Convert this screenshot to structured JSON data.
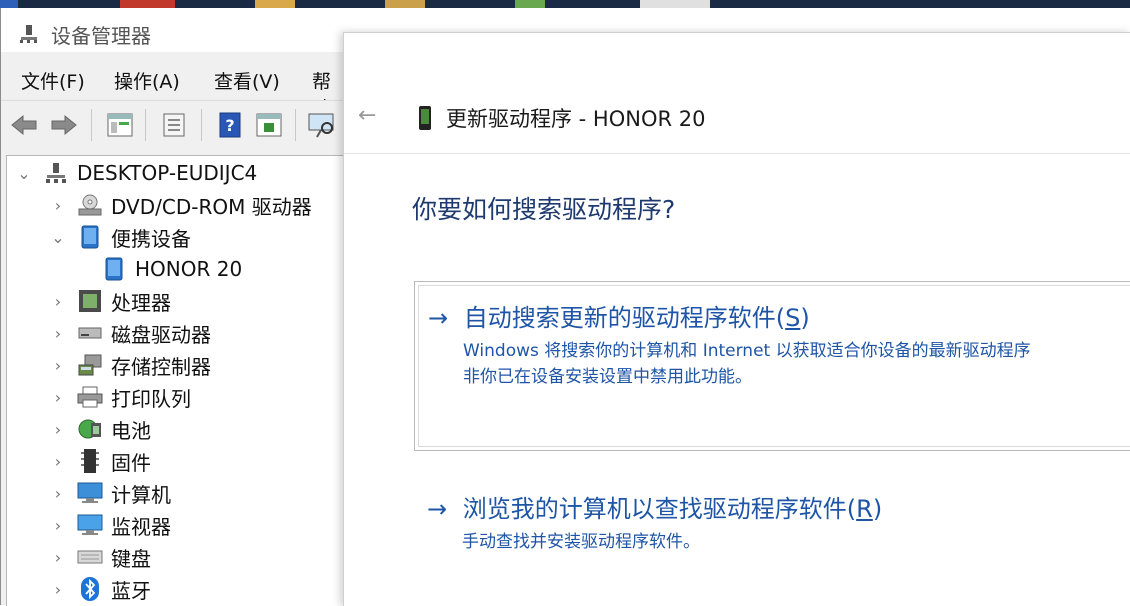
{
  "dm": {
    "title": "设备管理器",
    "menu": [
      "文件(F)",
      "操作(A)",
      "查看(V)",
      "帮助"
    ],
    "tree": {
      "root": "DESKTOP-EUDIJC4",
      "items": [
        {
          "label": "DVD/CD-ROM 驱动器",
          "icon": "dvd-drive-icon"
        },
        {
          "label": "便携设备",
          "icon": "portable-device-icon",
          "expanded": true
        },
        {
          "label": "HONOR 20",
          "icon": "phone-icon",
          "child": true
        },
        {
          "label": "处理器",
          "icon": "processor-icon"
        },
        {
          "label": "磁盘驱动器",
          "icon": "disk-drive-icon"
        },
        {
          "label": "存储控制器",
          "icon": "storage-controller-icon"
        },
        {
          "label": "打印队列",
          "icon": "printer-icon"
        },
        {
          "label": "电池",
          "icon": "battery-icon"
        },
        {
          "label": "固件",
          "icon": "firmware-icon"
        },
        {
          "label": "计算机",
          "icon": "computer-icon"
        },
        {
          "label": "监视器",
          "icon": "monitor-icon"
        },
        {
          "label": "键盘",
          "icon": "keyboard-icon"
        },
        {
          "label": "蓝牙",
          "icon": "bluetooth-icon"
        }
      ]
    }
  },
  "dialog": {
    "title": "更新驱动程序 - HONOR 20",
    "question": "你要如何搜索驱动程序?",
    "option1": {
      "arrow": "→",
      "title_pre": "自动搜索更新的驱动程序软件(",
      "title_key": "S",
      "title_post": ")",
      "desc_line1": "Windows 将搜索你的计算机和 Internet 以获取适合你设备的最新驱动程序",
      "desc_line2": "非你已在设备安装设置中禁用此功能。"
    },
    "option2": {
      "arrow": "→",
      "title_pre": "浏览我的计算机以查找驱动程序软件(",
      "title_key": "R",
      "title_post": ")",
      "desc_line1": "手动查找并安装驱动程序软件。"
    }
  },
  "colors": {
    "link_blue": "#1e55a6",
    "heading_blue": "#1e3a6e"
  }
}
